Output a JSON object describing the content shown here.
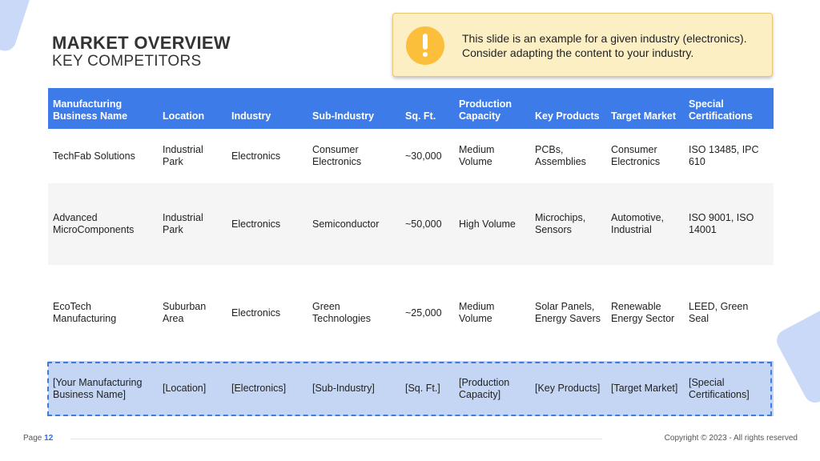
{
  "header": {
    "title": "MARKET OVERVIEW",
    "subtitle": "KEY COMPETITORS"
  },
  "note": {
    "icon": "exclamation-icon",
    "line1": "This slide is an example for a given industry (electronics).",
    "line2": "Consider adapting the content to your industry."
  },
  "table": {
    "columns": [
      "Manufacturing Business Name",
      "Location",
      "Industry",
      "Sub-Industry",
      "Sq. Ft.",
      "Production Capacity",
      "Key Products",
      "Target Market",
      "Special Certifications"
    ],
    "rows": [
      [
        "TechFab Solutions",
        "Industrial Park",
        "Electronics",
        "Consumer Electronics",
        "~30,000",
        "Medium Volume",
        "PCBs, Assemblies",
        "Consumer Electronics",
        "ISO 13485, IPC 610"
      ],
      [
        "Advanced MicroComponents",
        "Industrial Park",
        "Electronics",
        "Semiconductor",
        "~50,000",
        "High Volume",
        "Microchips, Sensors",
        "Automotive, Industrial",
        "ISO 9001, ISO 14001"
      ],
      [
        "EcoTech Manufacturing",
        "Suburban Area",
        "Electronics",
        "Green Technologies",
        "~25,000",
        "Medium Volume",
        "Solar Panels, Energy Savers",
        "Renewable Energy Sector",
        "LEED, Green Seal"
      ],
      [
        "[Your Manufacturing Business Name]",
        "[Location]",
        "[Electronics]",
        "[Sub-Industry]",
        "[Sq. Ft.]",
        "[Production Capacity]",
        "[Key Products]",
        "[Target Market]",
        "[Special Certifications]"
      ]
    ]
  },
  "footer": {
    "page_label": "Page",
    "page_number": "12",
    "copyright": "Copyright © 2023 - All rights reserved"
  },
  "colors": {
    "header_blue": "#3d7be8",
    "highlight_row": "#c4d6f4",
    "note_bg": "#fdefc4",
    "note_icon": "#fbbf3c"
  }
}
